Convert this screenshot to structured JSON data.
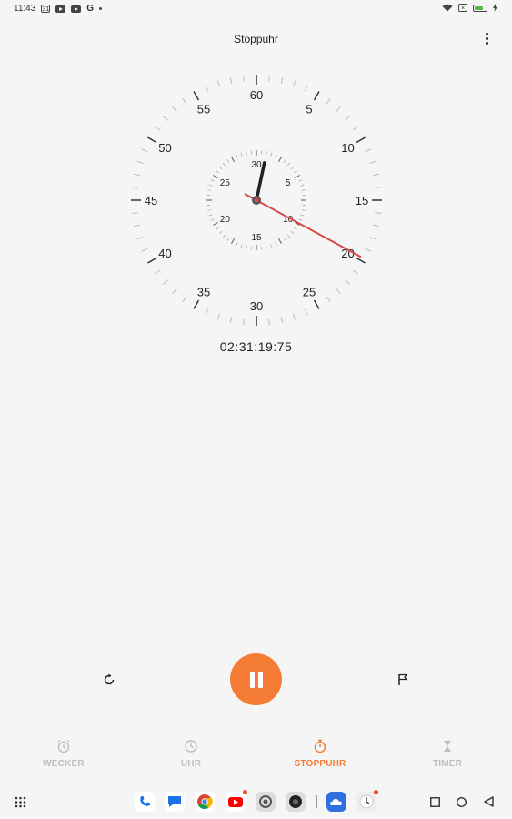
{
  "status_bar": {
    "time": "11:43",
    "calendar_day": "31",
    "google_letter": "G"
  },
  "header": {
    "title": "Stoppuhr"
  },
  "stopwatch": {
    "elapsed": "02:31:19:75",
    "dial_labels": [
      "60",
      "5",
      "10",
      "15",
      "20",
      "25",
      "30",
      "35",
      "40",
      "45",
      "50",
      "55"
    ],
    "subdial_labels": [
      "30",
      "5",
      "10",
      "15",
      "20",
      "25"
    ],
    "seconds_value": 19.75,
    "minutes_value": 31,
    "hand_color": "#d84a4a",
    "minute_hand_color": "#222222"
  },
  "controls": {
    "reset_icon": "reset-icon",
    "pause_icon": "pause-icon",
    "lap_icon": "flag-icon",
    "accent": "#f57c35"
  },
  "tabs": [
    {
      "label": "WECKER",
      "icon": "alarm-icon",
      "active": false
    },
    {
      "label": "UHR",
      "icon": "clock-icon",
      "active": false
    },
    {
      "label": "STOPPUHR",
      "icon": "stopwatch-icon",
      "active": true
    },
    {
      "label": "TIMER",
      "icon": "hourglass-icon",
      "active": false
    }
  ],
  "dock": {
    "apps": [
      "phone-icon",
      "messages-icon",
      "chrome-icon",
      "youtube-icon",
      "settings-icon",
      "camera-icon",
      "weather-icon",
      "clock-app-icon"
    ]
  }
}
